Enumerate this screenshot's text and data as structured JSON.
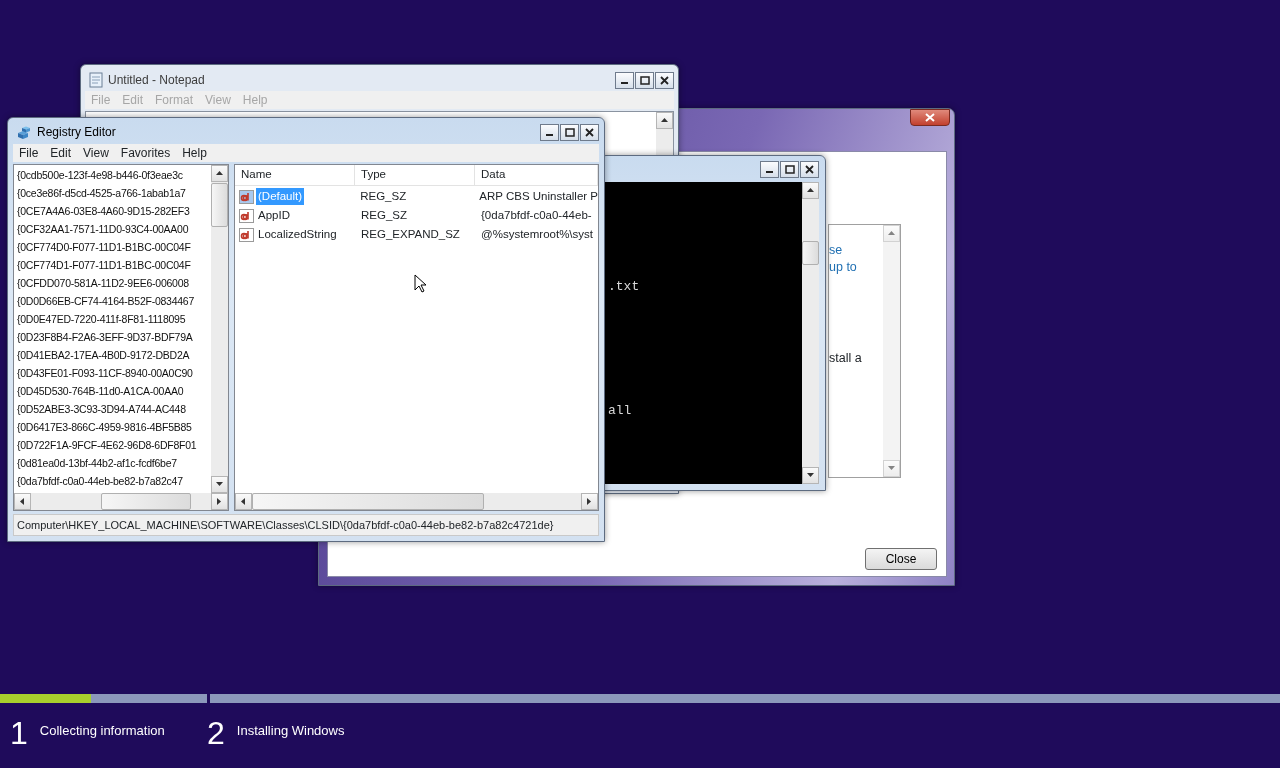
{
  "setup_dialog": {
    "paragraphs": [
      {
        "kind": "link",
        "lines": [
          "se",
          "up to"
        ]
      },
      {
        "kind": "plain",
        "lines": [
          "stall a"
        ]
      }
    ],
    "close_button": "Close"
  },
  "notepad": {
    "title": "Untitled - Notepad",
    "active": false,
    "menu": [
      "File",
      "Edit",
      "Format",
      "View",
      "Help"
    ]
  },
  "console": {
    "lines": [
      ".txt",
      "all"
    ]
  },
  "registry_editor": {
    "title": "Registry Editor",
    "active": true,
    "menu": [
      "File",
      "Edit",
      "View",
      "Favorites",
      "Help"
    ],
    "tree": [
      {
        "label": "{0cdb500e-123f-4e98-b446-0f3eae3c",
        "selected": false
      },
      {
        "label": "{0ce3e86f-d5cd-4525-a766-1abab1a7",
        "selected": false
      },
      {
        "label": "{0CE7A4A6-03E8-4A60-9D15-282EF3",
        "selected": false
      },
      {
        "label": "{0CF32AA1-7571-11D0-93C4-00AA00",
        "selected": false
      },
      {
        "label": "{0CF774D0-F077-11D1-B1BC-00C04F",
        "selected": false
      },
      {
        "label": "{0CF774D1-F077-11D1-B1BC-00C04F",
        "selected": false
      },
      {
        "label": "{0CFDD070-581A-11D2-9EE6-006008",
        "selected": false
      },
      {
        "label": "{0D0D66EB-CF74-4164-B52F-0834467",
        "selected": false
      },
      {
        "label": "{0D0E47ED-7220-411f-8F81-1118095",
        "selected": false
      },
      {
        "label": "{0D23F8B4-F2A6-3EFF-9D37-BDF79A",
        "selected": false
      },
      {
        "label": "{0D41EBA2-17EA-4B0D-9172-DBD2A",
        "selected": false
      },
      {
        "label": "{0D43FE01-F093-11CF-8940-00A0C90",
        "selected": false
      },
      {
        "label": "{0D45D530-764B-11d0-A1CA-00AA0",
        "selected": false
      },
      {
        "label": "{0D52ABE3-3C93-3D94-A744-AC448",
        "selected": false
      },
      {
        "label": "{0D6417E3-866C-4959-9816-4BF5B85",
        "selected": false
      },
      {
        "label": "{0D722F1A-9FCF-4E62-96D8-6DF8F01",
        "selected": false
      },
      {
        "label": "{0d81ea0d-13bf-44b2-af1c-fcdf6be7",
        "selected": false
      },
      {
        "label": "{0da7bfdf-c0a0-44eb-be82-b7a82c47",
        "selected": false
      }
    ],
    "columns": [
      "Name",
      "Type",
      "Data"
    ],
    "values": [
      {
        "name": "(Default)",
        "type": "REG_SZ",
        "data": "ARP CBS Uninstaller P",
        "selected": true
      },
      {
        "name": "AppID",
        "type": "REG_SZ",
        "data": "{0da7bfdf-c0a0-44eb-",
        "selected": false
      },
      {
        "name": "LocalizedString",
        "type": "REG_EXPAND_SZ",
        "data": "@%systemroot%\\syst",
        "selected": false
      }
    ],
    "status_bar": "Computer\\HKEY_LOCAL_MACHINE\\SOFTWARE\\Classes\\CLSID\\{0da7bfdf-c0a0-44eb-be82-b7a82c4721de}"
  },
  "setup_progress": {
    "steps": [
      {
        "number": "1",
        "label": "Collecting information",
        "level": 0.44
      },
      {
        "number": "2",
        "label": "Installing Windows",
        "level": 0
      }
    ]
  }
}
